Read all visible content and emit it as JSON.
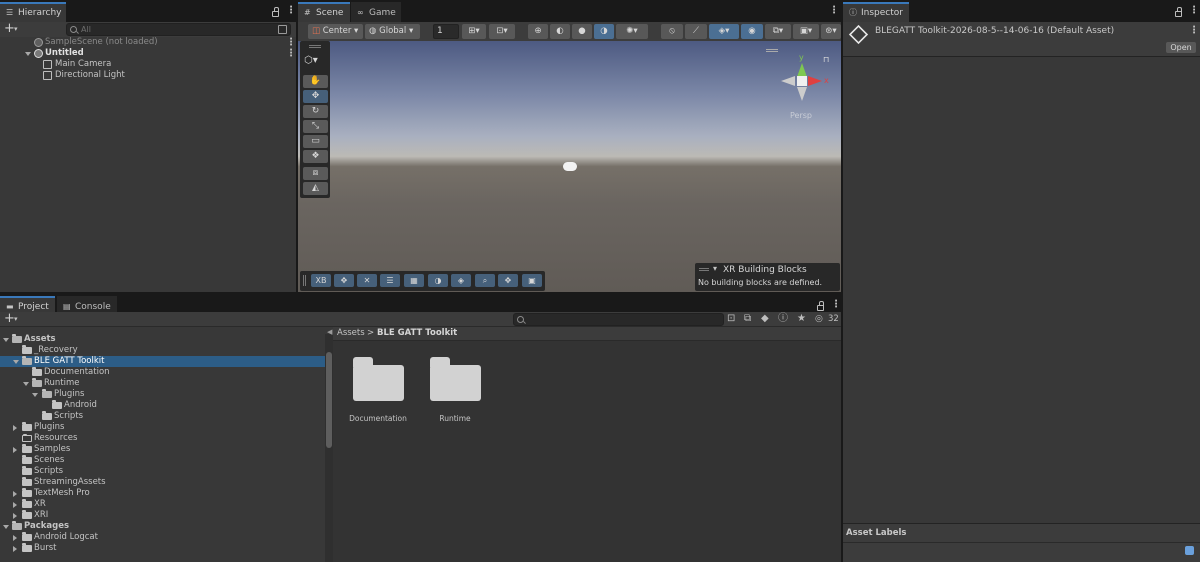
{
  "hierarchy": {
    "tab_label": "Hierarchy",
    "search_placeholder": "All",
    "add_label": "+",
    "items": [
      {
        "label": "SampleScene (not loaded)"
      },
      {
        "label": "Untitled"
      },
      {
        "label": "Main Camera"
      },
      {
        "label": "Directional Light"
      }
    ]
  },
  "scene": {
    "tabs": [
      {
        "label": "Scene"
      },
      {
        "label": "Game"
      }
    ],
    "pivot_label": "Center",
    "space_label": "Global",
    "grid_value": "1",
    "overlay": {
      "title": "XR Building Blocks",
      "message": "No building blocks are defined."
    },
    "gizmo": {
      "axis_y": "y",
      "axis_x": "x",
      "axis_z": "z",
      "projection": "Persp"
    },
    "bottom_toolbar_first": "XB"
  },
  "inspector": {
    "tab_label": "Inspector",
    "asset_title": "BLEGATT Toolkit-2026-08-5--14-06-16 (Default Asset)",
    "open_label": "Open",
    "labels_header": "Asset Labels"
  },
  "project": {
    "tabs": [
      {
        "label": "Project"
      },
      {
        "label": "Console"
      }
    ],
    "add_label": "+",
    "hidden_count": "32",
    "breadcrumb": {
      "root": "Assets",
      "separator": ">",
      "current": "BLE GATT Toolkit"
    },
    "tree": [
      {
        "label": "Assets",
        "bold": true
      },
      {
        "label": "_Recovery"
      },
      {
        "label": "BLE GATT Toolkit"
      },
      {
        "label": "Documentation"
      },
      {
        "label": "Runtime"
      },
      {
        "label": "Plugins"
      },
      {
        "label": "Android"
      },
      {
        "label": "Scripts"
      },
      {
        "label": "Plugins"
      },
      {
        "label": "Resources"
      },
      {
        "label": "Samples"
      },
      {
        "label": "Scenes"
      },
      {
        "label": "Scripts"
      },
      {
        "label": "StreamingAssets"
      },
      {
        "label": "TextMesh Pro"
      },
      {
        "label": "XR"
      },
      {
        "label": "XRI"
      },
      {
        "label": "Packages",
        "bold": true
      },
      {
        "label": "Android Logcat"
      },
      {
        "label": "Burst"
      }
    ],
    "grid_items": [
      {
        "label": "Documentation"
      },
      {
        "label": "Runtime"
      }
    ]
  }
}
